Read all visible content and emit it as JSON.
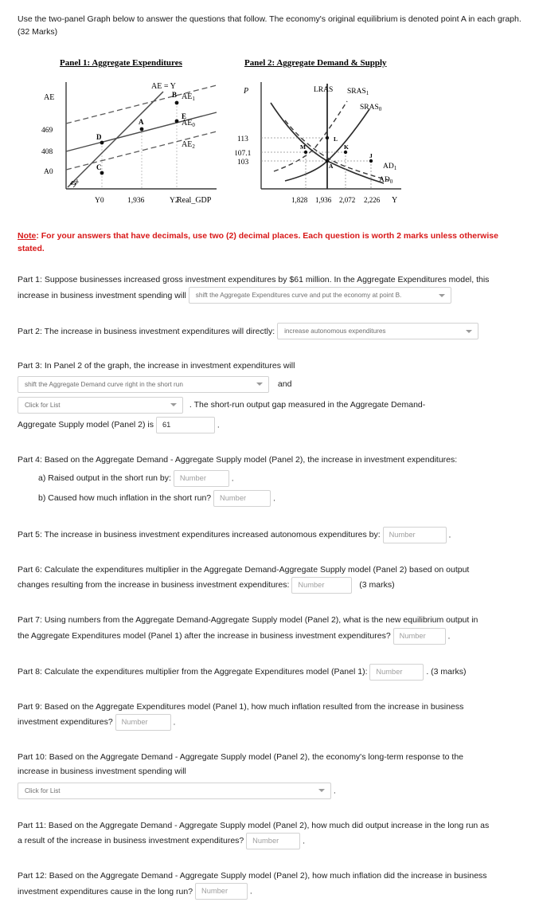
{
  "intro": "Use the two-panel Graph below to answer the questions that follow. The economy's original equilibrium is denoted point A in each graph. (32 Marks)",
  "note": {
    "label": "Note",
    "text": ": For your answers that have decimals, use two (2) decimal places. Each question is worth 2 marks unless otherwise stated."
  },
  "panel1": {
    "title": "Panel 1: Aggregate Expenditures",
    "y_axis_label": "AE",
    "x_axis_label": "Real_GDP",
    "y_ticks": [
      "469",
      "408",
      "A0"
    ],
    "x_ticks": [
      "Y0",
      "1,936",
      "Y2"
    ],
    "angle_label": "45°",
    "curve_labels": [
      "AE = Y",
      "AE1",
      "AE0",
      "AE2"
    ],
    "points": [
      "A",
      "B",
      "C",
      "D",
      "E"
    ]
  },
  "panel2": {
    "title": "Panel 2: Aggregate Demand & Supply",
    "y_axis_label": "P",
    "x_axis_label": "Y",
    "y_ticks": [
      "113",
      "107.1",
      "103"
    ],
    "x_ticks": [
      "1,828",
      "1,936",
      "2,072",
      "2,226"
    ],
    "curve_labels": [
      "LRAS",
      "SRAS1",
      "SRAS0",
      "AD1",
      "AD0"
    ],
    "points": [
      "A",
      "J",
      "K",
      "L",
      "M"
    ]
  },
  "chart_data": [
    {
      "type": "line",
      "title": "Panel 1: Aggregate Expenditures",
      "xlabel": "Real_GDP",
      "ylabel": "AE",
      "ytick_labels": [
        "A0",
        "408",
        "469"
      ],
      "xtick_labels": [
        "Y0",
        "1,936",
        "Y2"
      ],
      "series": [
        {
          "name": "AE = Y",
          "style": "solid",
          "note": "45-degree line through origin"
        },
        {
          "name": "AE1",
          "style": "dashed",
          "note": "highest aggregate expenditures line, passes through B"
        },
        {
          "name": "AE0",
          "style": "solid",
          "note": "original aggregate expenditures line, passes through D, A, E"
        },
        {
          "name": "AE2",
          "style": "dashed",
          "note": "lowest aggregate expenditures line, passes through C"
        }
      ],
      "annotations": [
        {
          "label": "A",
          "x": "1,936",
          "y": "469",
          "note": "original equilibrium on AE0 and AE=Y"
        },
        {
          "label": "B",
          "x": "Y2",
          "y": "above 469",
          "note": "AE1 intersects AE=Y"
        },
        {
          "label": "C",
          "x": "Y0",
          "y": "A0",
          "note": "AE2 intersects AE=Y"
        },
        {
          "label": "D",
          "x": "Y0",
          "y": "between 408 and 469",
          "note": "on AE0"
        },
        {
          "label": "E",
          "x": "Y2",
          "y": "469",
          "note": "on AE0"
        },
        {
          "label": "45°",
          "x": "origin",
          "y": "origin",
          "note": "angle of AE=Y line"
        }
      ]
    },
    {
      "type": "line",
      "title": "Panel 2: Aggregate Demand & Supply",
      "xlabel": "Y",
      "ylabel": "P",
      "ytick_labels": [
        "103",
        "107.1",
        "113"
      ],
      "xtick_labels": [
        "1,828",
        "1,936",
        "2,072",
        "2,226"
      ],
      "series": [
        {
          "name": "LRAS",
          "style": "solid-vertical",
          "x": "1,936"
        },
        {
          "name": "SRAS1",
          "style": "dashed",
          "note": "shifted-left short run aggregate supply, through L"
        },
        {
          "name": "SRAS0",
          "style": "solid",
          "note": "original short run aggregate supply, through M, A, K"
        },
        {
          "name": "AD1",
          "style": "dashed",
          "note": "shifted-right aggregate demand, through M, K, J"
        },
        {
          "name": "AD0",
          "style": "solid",
          "note": "original aggregate demand, through A"
        }
      ],
      "annotations": [
        {
          "label": "A",
          "x": "1,936",
          "y": "103",
          "note": "original equilibrium"
        },
        {
          "label": "K",
          "x": "2,072",
          "y": "107.1",
          "note": "short run equilibrium AD1 x SRAS0"
        },
        {
          "label": "L",
          "x": "1,936",
          "y": "113",
          "note": "long run equilibrium AD1 x SRAS1 x LRAS"
        },
        {
          "label": "M",
          "x": "1,828",
          "y": "107.1",
          "note": "on SRAS0 and AD1"
        },
        {
          "label": "J",
          "x": "2,226",
          "y": "103",
          "note": "on AD1"
        }
      ]
    }
  ],
  "parts": {
    "p1": {
      "line1": "Part 1: Suppose businesses increased gross investment expenditures by $61 million. In the Aggregate Expenditures model, this",
      "line2": "increase in business investment spending will",
      "select": "shift the Aggregate Expenditures curve and put the economy at point B."
    },
    "p2": {
      "text": "Part 2: The increase in business investment expenditures will directly:",
      "select": "increase autonomous expenditures"
    },
    "p3": {
      "line1": "Part 3: In Panel 2 of the graph, the increase in investment expenditures will",
      "select1": "shift the Aggregate Demand curve right in the short run",
      "and": "and",
      "select2": "Click for List",
      "tail1": ". The short-run output gap measured in the Aggregate Demand-",
      "line3": "Aggregate Supply model (Panel 2) is",
      "value": "61",
      "period": "."
    },
    "p4": {
      "text": "Part 4: Based on the Aggregate Demand - Aggregate Supply model (Panel 2), the increase in investment expenditures:",
      "a_label": "a) Raised output in the short run by:",
      "a_placeholder": "Number",
      "b_label": "b) Caused how much inflation in the short run?",
      "b_placeholder": "Number",
      "period": "."
    },
    "p5": {
      "text": "Part 5: The increase in business investment expenditures increased autonomous expenditures by:",
      "placeholder": "Number",
      "period": "."
    },
    "p6": {
      "line1": "Part 6: Calculate the expenditures multiplier in the Aggregate Demand-Aggregate Supply model (Panel 2) based on output",
      "line2": "changes resulting from the increase in business investment expenditures:",
      "placeholder": "Number",
      "marks": "(3 marks)"
    },
    "p7": {
      "line1": "Part 7: Using numbers from the Aggregate Demand-Aggregate Supply model (Panel 2), what is the new equilibrium output  in",
      "line2": "the Aggregate Expenditures model (Panel 1) after the increase in business investment expenditures?",
      "placeholder": "Number",
      "period": "."
    },
    "p8": {
      "text": "Part 8: Calculate the expenditures multiplier from the Aggregate Expenditures model (Panel 1):",
      "placeholder": "Number",
      "marks": ". (3 marks)"
    },
    "p9": {
      "line1": "Part 9: Based on the Aggregate Expenditures model (Panel 1), how much inflation resulted from the increase in business",
      "line2": "investment expenditures?",
      "placeholder": "Number",
      "period": "."
    },
    "p10": {
      "line1": "Part 10: Based on the Aggregate Demand - Aggregate Supply model (Panel 2), the economy's long-term response to the",
      "line2": "increase in business investment spending will",
      "select": "Click for List",
      "period": "."
    },
    "p11": {
      "line1": "Part 11: Based on the Aggregate Demand - Aggregate Supply model (Panel 2), how much did output increase in the long run as",
      "line2": "a result of the increase in business investment expenditures?",
      "placeholder": "Number",
      "period": "."
    },
    "p12": {
      "line1": "Part 12: Based on the Aggregate Demand - Aggregate Supply model (Panel 2), how much inflation did the increase in business",
      "line2": "investment expenditures cause in the long run?",
      "placeholder": "Number",
      "period": "."
    }
  }
}
